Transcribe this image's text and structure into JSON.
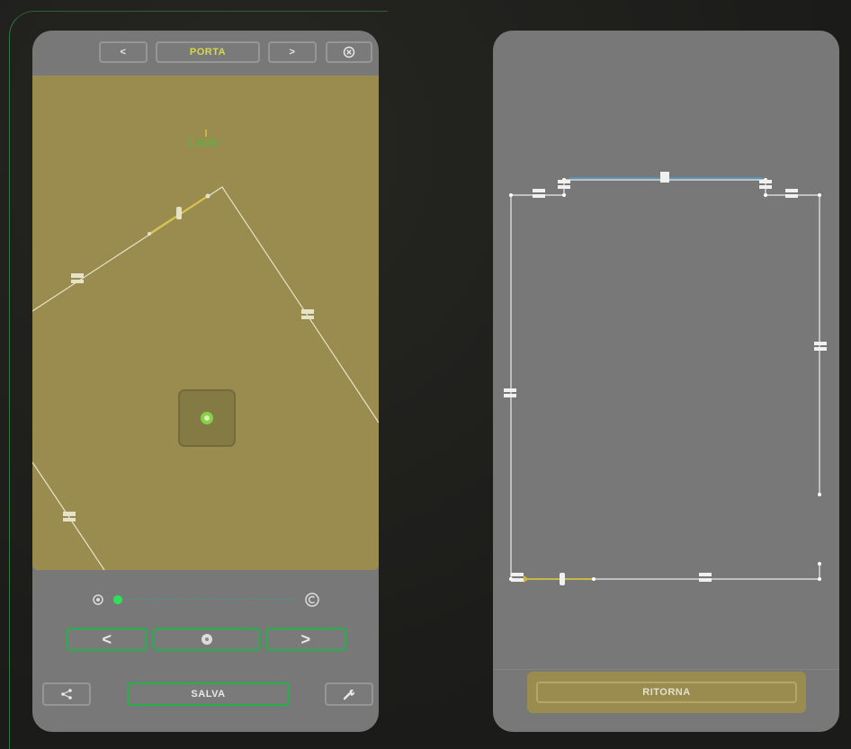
{
  "left_panel": {
    "header": {
      "prev_label": "<",
      "title": "PORTA",
      "next_label": ">"
    },
    "canvas": {
      "angle_readout": "0.000°"
    },
    "nav": {
      "back_label": "<",
      "forward_label": ">"
    },
    "footer": {
      "save_label": "SALVA"
    }
  },
  "right_panel": {
    "return_label": "RITORNA"
  },
  "colors": {
    "panel_gray": "#787878",
    "canvas_gold": "#9a8b4f",
    "accent_green": "#24b04a",
    "title_yellow": "#d8d84a",
    "wall_line": "#e6e2c8",
    "blue_line": "#4aa0c8"
  },
  "icons": {
    "close": "close-circle-icon",
    "center": "target-icon",
    "rotate": "rotate-icon",
    "share": "share-icon",
    "tools": "wrench-icon"
  }
}
